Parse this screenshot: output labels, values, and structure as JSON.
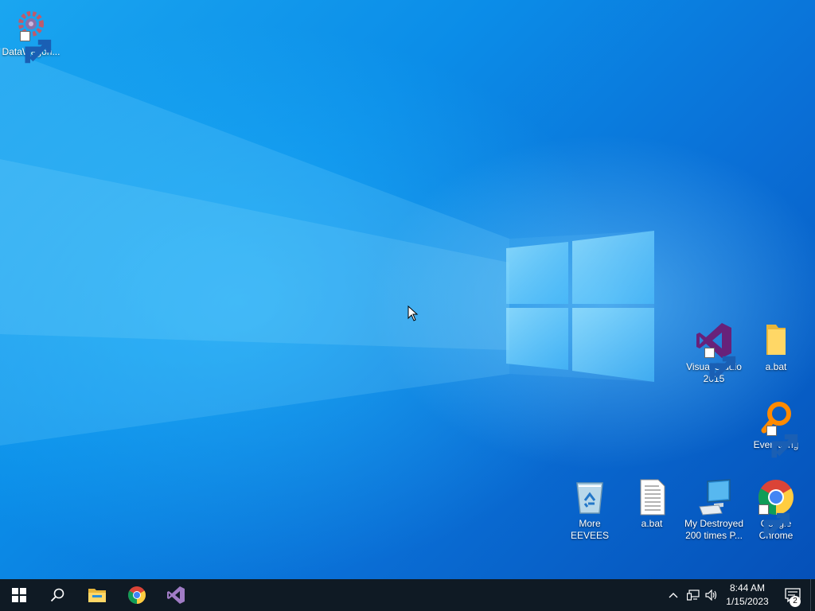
{
  "desktop": {
    "icons": [
      {
        "label": "DataWagon..."
      },
      {
        "label": "Visual Studio 2015"
      },
      {
        "label": "a.bat"
      },
      {
        "label": "Everything"
      },
      {
        "label": "More EEVEES"
      },
      {
        "label": "a.bat"
      },
      {
        "label": "My Destroyed 200 times P..."
      },
      {
        "label": "Google Chrome"
      }
    ]
  },
  "taskbar": {
    "pinned": [
      "start-icon",
      "search-icon",
      "file-explorer-icon",
      "chrome-icon",
      "visual-studio-icon"
    ],
    "tray_icons": [
      "chevron-up-icon",
      "network-icon",
      "volume-icon"
    ],
    "clock": {
      "time": "8:44 AM",
      "date": "1/15/2023"
    },
    "notification_count": "2"
  },
  "colors": {
    "taskbar_bg": "#0f1a24",
    "desktop_accent": "#0a78d6",
    "vs_purple": "#68217a"
  }
}
